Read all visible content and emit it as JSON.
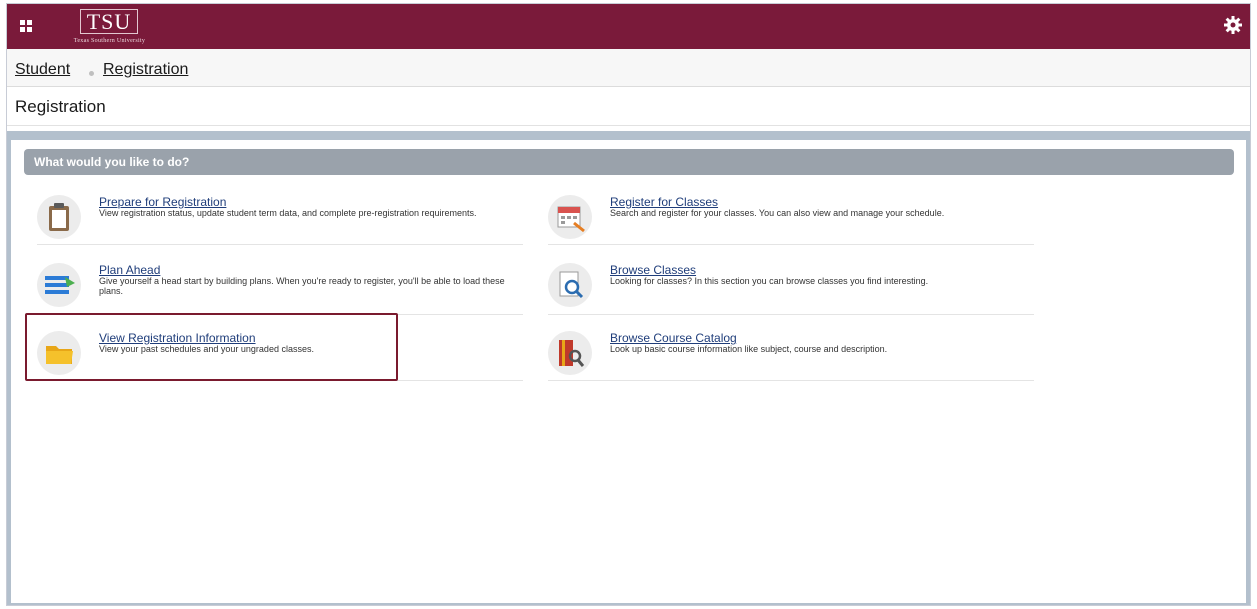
{
  "app": {
    "logo_text": "TSU",
    "logo_subtitle": "Texas Southern University"
  },
  "breadcrumb": {
    "items": [
      "Student",
      "Registration"
    ]
  },
  "page": {
    "title": "Registration"
  },
  "panel": {
    "heading": "What would you like to do?",
    "left_items": [
      {
        "label": "Prepare for Registration",
        "description": "View registration status, update student term data, and complete pre-registration requirements.",
        "icon": "clipboard-icon"
      },
      {
        "label": "Plan Ahead",
        "description": "Give yourself a head start by building plans. When you're ready to register, you'll be able to load these plans.",
        "icon": "plan-ahead-icon"
      },
      {
        "label": "View Registration Information",
        "description": "View your past schedules and your ungraded classes.",
        "icon": "folder-icon"
      }
    ],
    "right_items": [
      {
        "label": "Register for Classes",
        "description": "Search and register for your classes. You can also view and manage your schedule.",
        "icon": "calendar-icon"
      },
      {
        "label": "Browse Classes",
        "description": "Looking for classes? In this section you can browse classes you find interesting.",
        "icon": "browse-classes-icon"
      },
      {
        "label": "Browse Course Catalog",
        "description": "Look up basic course information like subject, course and description.",
        "icon": "catalog-icon"
      }
    ]
  },
  "colors": {
    "brand": "#7a1a3a",
    "heading_bar": "#9aa2ab",
    "link": "#1f3d7a",
    "highlight_border": "#7a1a2e"
  }
}
